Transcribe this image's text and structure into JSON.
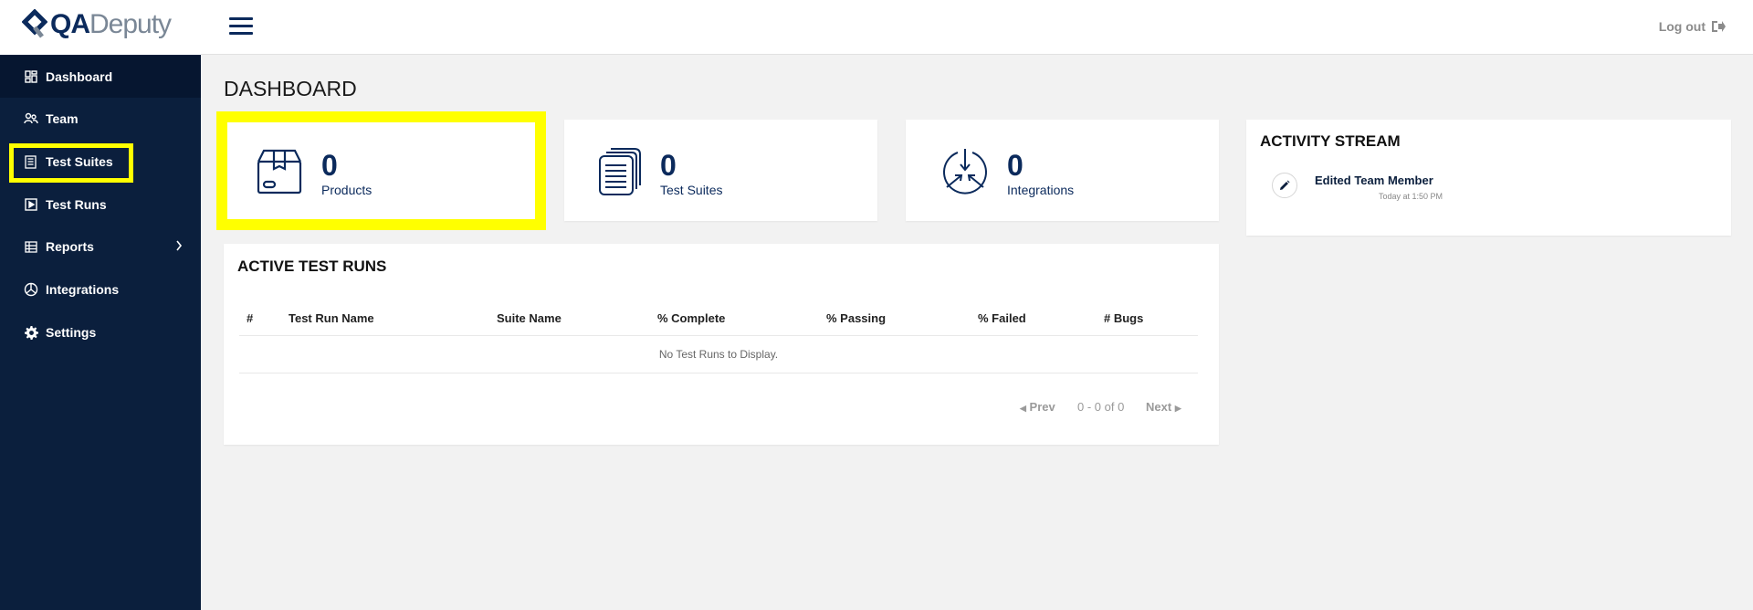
{
  "app": {
    "logo_qa": "QA",
    "logo_deputy": "Deputy"
  },
  "sidebar": {
    "items": [
      {
        "label": "Dashboard",
        "icon": "dashboard-icon"
      },
      {
        "label": "Team",
        "icon": "team-icon"
      },
      {
        "label": "Test Suites",
        "icon": "test-suites-icon"
      },
      {
        "label": "Test Runs",
        "icon": "test-runs-icon"
      },
      {
        "label": "Reports",
        "icon": "reports-icon"
      },
      {
        "label": "Integrations",
        "icon": "integrations-icon"
      },
      {
        "label": "Settings",
        "icon": "gear-icon"
      }
    ]
  },
  "header": {
    "logout": "Log out"
  },
  "page": {
    "title": "DASHBOARD"
  },
  "stats": [
    {
      "value": "0",
      "label": "Products",
      "icon": "box-icon"
    },
    {
      "value": "0",
      "label": "Test Suites",
      "icon": "documents-icon"
    },
    {
      "value": "0",
      "label": "Integrations",
      "icon": "integrations-icon"
    }
  ],
  "active_runs": {
    "title": "ACTIVE TEST RUNS",
    "columns": [
      "#",
      "Test Run Name",
      "Suite Name",
      "% Complete",
      "% Passing",
      "% Failed",
      "# Bugs"
    ],
    "empty": "No Test Runs to Display.",
    "pager": {
      "prev": "Prev",
      "range": "0 - 0 of 0",
      "next": "Next"
    }
  },
  "activity": {
    "title": "ACTIVITY STREAM",
    "items": [
      {
        "title": "Edited Team Member",
        "time": "Today at 1:50 PM",
        "icon": "pencil-icon"
      }
    ]
  },
  "colors": {
    "sidebar": "#0b1f3d",
    "brand": "#0b2a5c",
    "highlight": "#ffff00"
  }
}
